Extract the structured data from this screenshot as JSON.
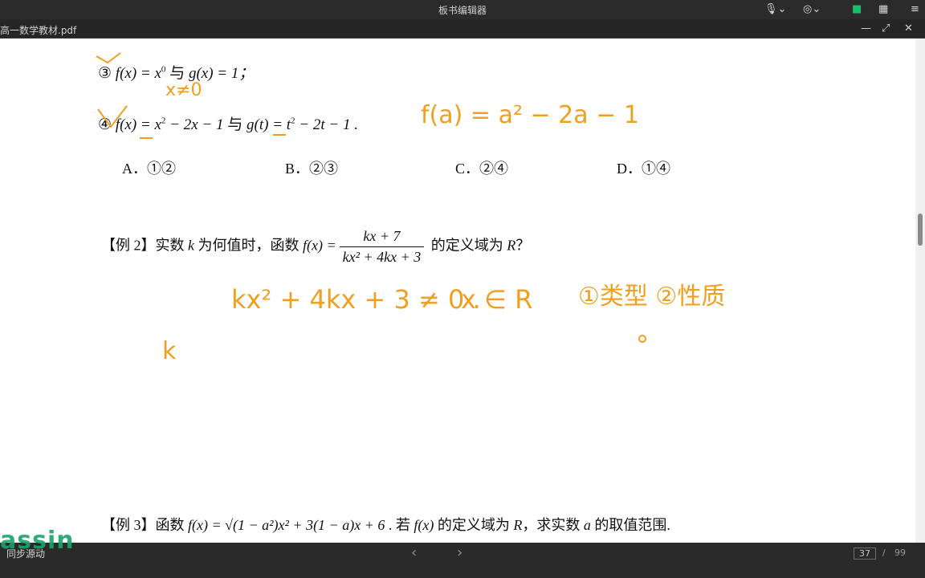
{
  "app": {
    "title": "板书编辑器",
    "doc_tab": "高一数学教材.pdf",
    "icons": [
      "microphone-icon",
      "webcam-icon",
      "camera-icon",
      "grid-icon",
      "menu-icon"
    ]
  },
  "window": {
    "minimize": "—",
    "restore": "⤢",
    "close": "✕"
  },
  "content": {
    "item3": {
      "num": "③",
      "lhs": "f(x) = x",
      "lhs_sup": "0",
      "connector": "与",
      "rhs": "g(x) = 1；"
    },
    "item4": {
      "num": "④",
      "lhs": "f(x) = x",
      "lhs_sup": "2",
      "lhs_rest": " − 2x − 1",
      "connector": "与",
      "rhs": "g(t) = t",
      "rhs_sup": "2",
      "rhs_rest": " − 2t − 1 ."
    },
    "choices": [
      {
        "letter": "A．",
        "value": "①②"
      },
      {
        "letter": "B．",
        "value": "②③"
      },
      {
        "letter": "C．",
        "value": "②④"
      },
      {
        "letter": "D．",
        "value": "①④"
      }
    ],
    "example2": {
      "tag": "【例 2】",
      "text_before": "实数 ",
      "var": "k",
      "text_mid": " 为何值时，函数 ",
      "func": "f(x) =",
      "num": "kx + 7",
      "den": "kx² + 4kx + 3",
      "text_after": " 的定义域为 ",
      "domain": "R",
      "end": "？"
    },
    "example3": {
      "tag": "【例 3】",
      "text1": "函数 ",
      "func": "f(x) = √(1 − a²)x² + 3(1 − a)x + 6",
      "text2": " . 若 ",
      "func2": "f(x)",
      "text3": " 的定义域为 ",
      "domain": "R",
      "text4": "，求实数 ",
      "var": "a",
      "text5": " 的取值范围."
    }
  },
  "handwriting": {
    "note1": "x≠0",
    "note2": "f(a) = a² − 2a − 1",
    "note3": "kx² + 4kx + 3 ≠ 0 .",
    "note4": "x ∈ R",
    "note5": "①类型 ②性质",
    "note6": "k"
  },
  "footer": {
    "prev": "‹",
    "next": "›",
    "page_current": "37",
    "page_sep": "/",
    "page_total": "99",
    "sync": "同步源动",
    "watermark": "assin"
  },
  "colors": {
    "ink": "#f0a020",
    "text": "#111111",
    "accent": "#1aa36a"
  }
}
